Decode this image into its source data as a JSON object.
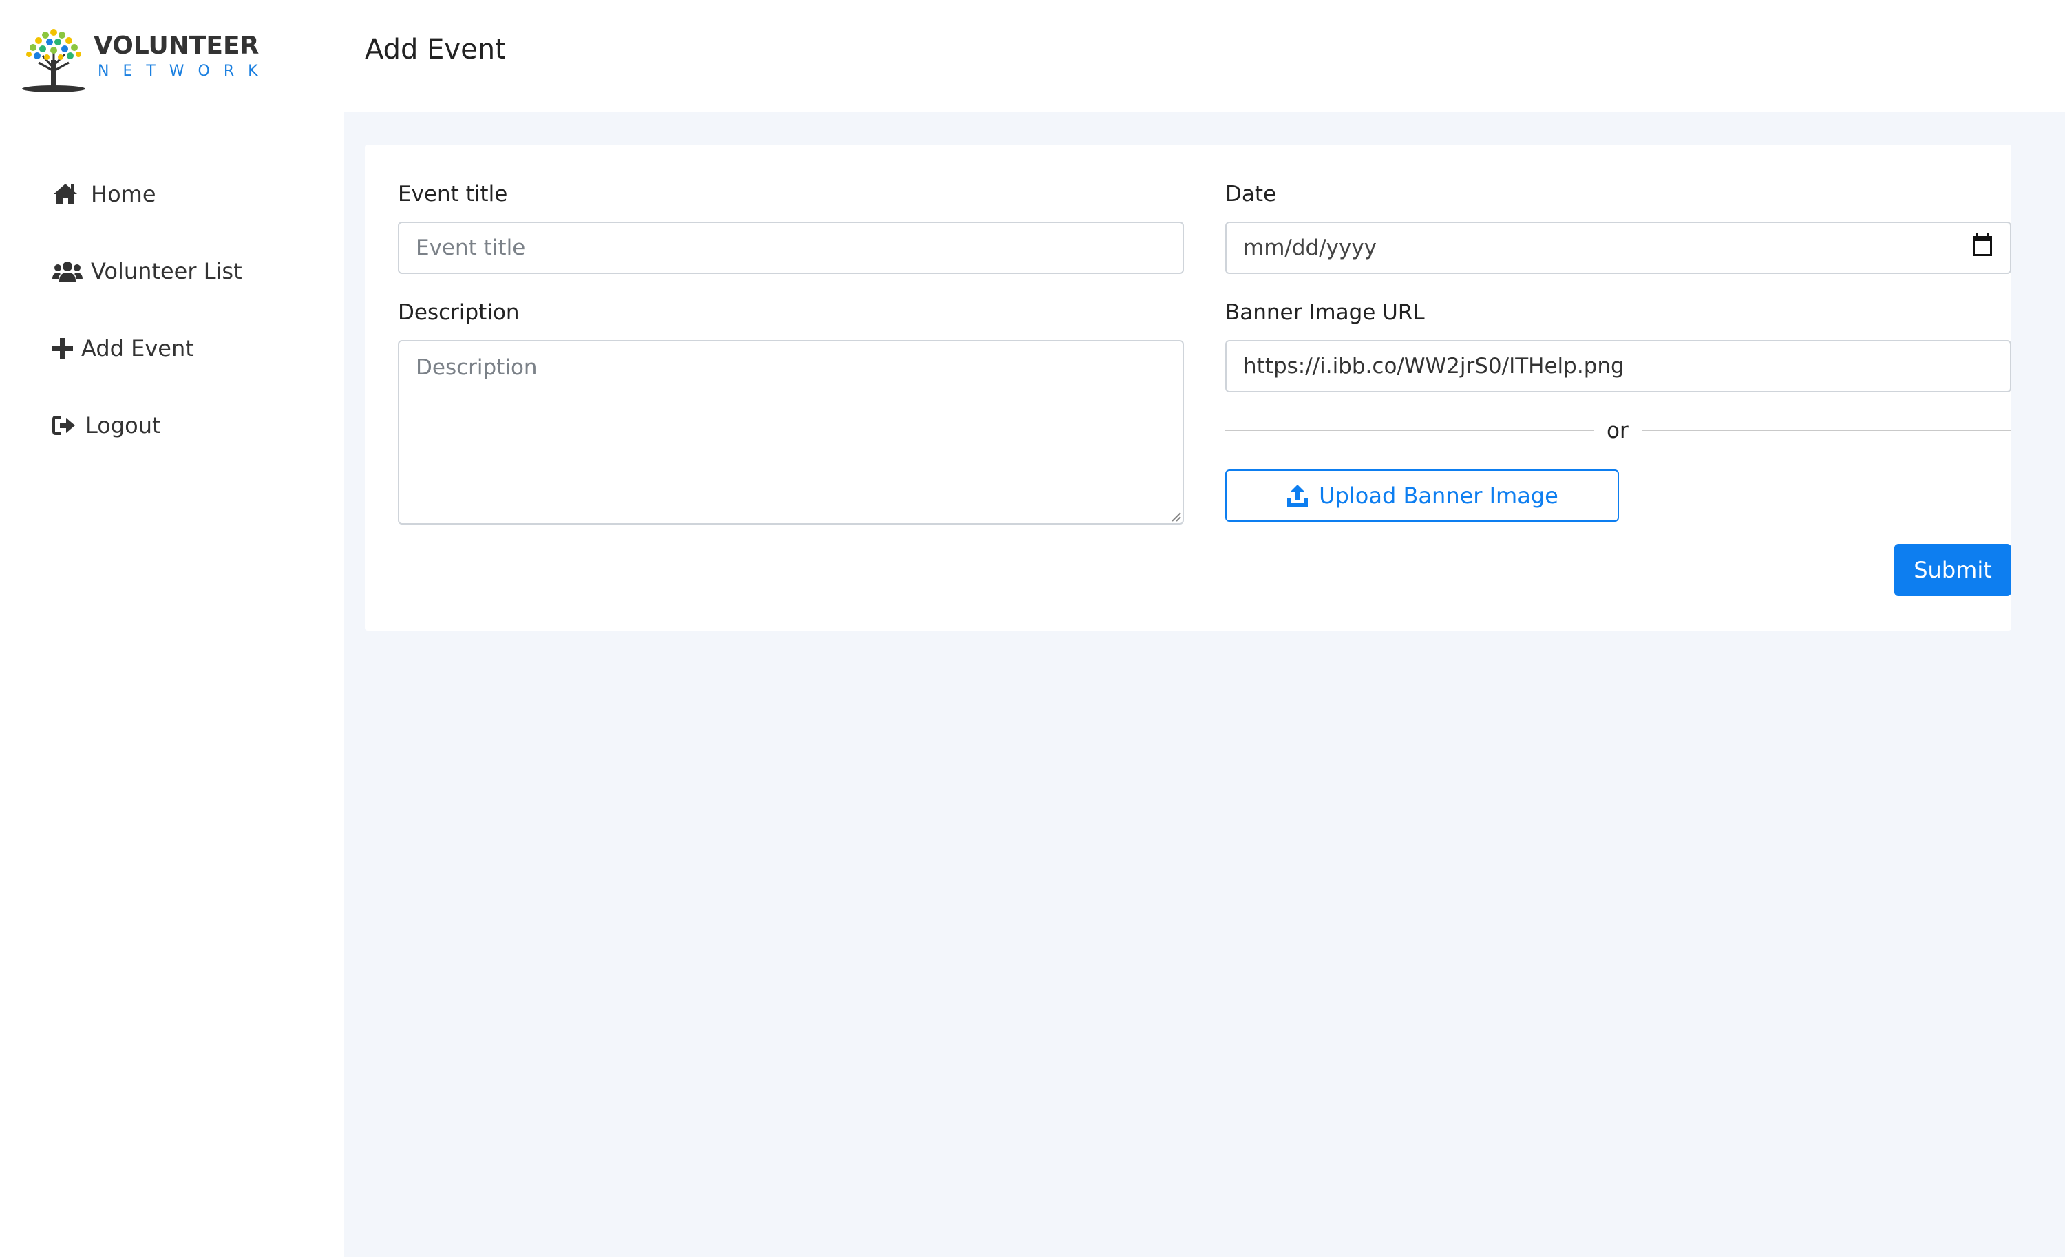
{
  "brand": {
    "line1": "VOLUNTEER",
    "line2": "NETWORK",
    "accent_color": "#1a7fe0"
  },
  "header": {
    "title": "Add Event"
  },
  "sidebar": {
    "items": [
      {
        "label": "Home",
        "icon": "home-icon"
      },
      {
        "label": "Volunteer List",
        "icon": "users-icon"
      },
      {
        "label": "Add Event",
        "icon": "plus-icon"
      },
      {
        "label": "Logout",
        "icon": "logout-icon"
      }
    ]
  },
  "form": {
    "event_title": {
      "label": "Event title",
      "placeholder": "Event title",
      "value": ""
    },
    "date": {
      "label": "Date",
      "placeholder": "mm/dd/yyyy",
      "icon": "calendar-icon"
    },
    "description": {
      "label": "Description",
      "placeholder": "Description",
      "value": ""
    },
    "banner_url": {
      "label": "Banner Image URL",
      "value": "https://i.ibb.co/WW2jrS0/ITHelp.png"
    },
    "or_text": "or",
    "upload_label": "Upload Banner Image",
    "upload_icon": "upload-icon",
    "submit_label": "Submit"
  },
  "colors": {
    "primary": "#0d7ef0",
    "main_bg": "#f3f6fb"
  }
}
